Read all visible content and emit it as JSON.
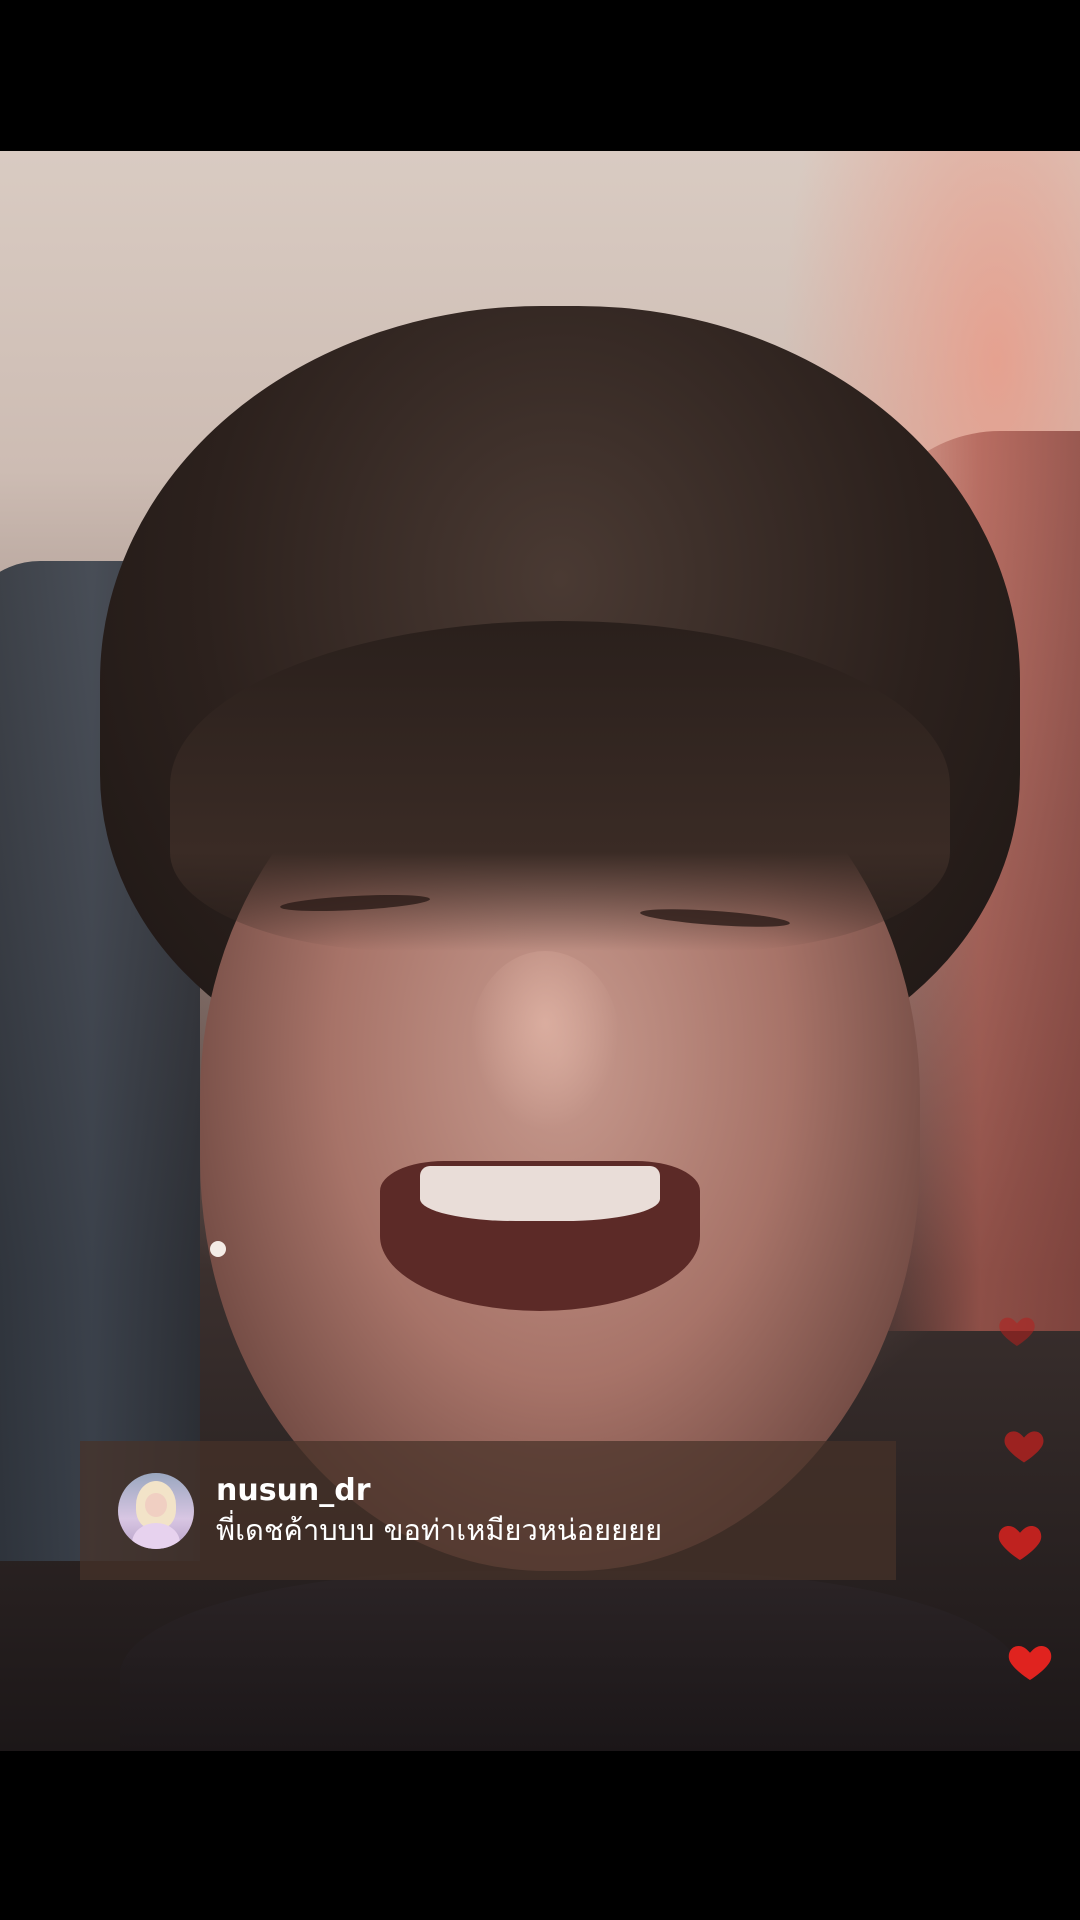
{
  "comment": {
    "username": "nusun_dr",
    "message": "พี่เดชค้าบบบ ขอท่าเหมียวหน่อยยยย"
  },
  "hearts": [
    {
      "icon": "heart-icon",
      "color": "#c0211f"
    },
    {
      "icon": "heart-icon",
      "color": "#c0211f"
    },
    {
      "icon": "heart-icon",
      "color": "#d0221f"
    },
    {
      "icon": "heart-icon",
      "color": "#e0231f"
    }
  ],
  "colors": {
    "heart": "#d9231f",
    "comment_bg": "rgba(70, 50, 40, 0.72)"
  }
}
